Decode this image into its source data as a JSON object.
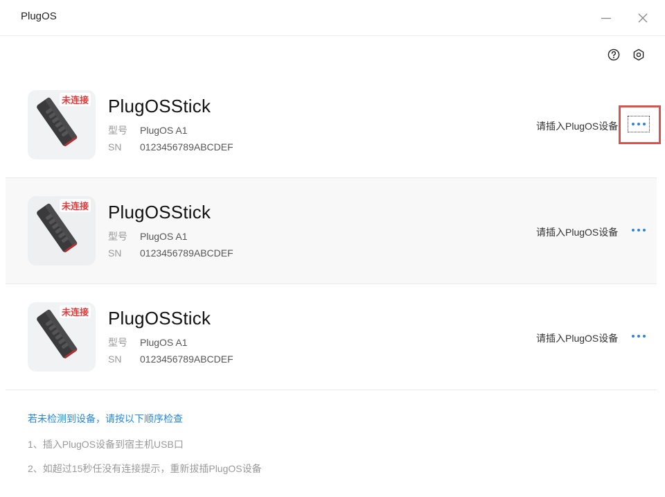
{
  "window": {
    "title": "PlugOS"
  },
  "devices": [
    {
      "status": "未连接",
      "name": "PlugOSStick",
      "model_label": "型号",
      "model": "PlugOS A1",
      "sn_label": "SN",
      "sn": "0123456789ABCDEF",
      "hint": "请插入PlugOS设备"
    },
    {
      "status": "未连接",
      "name": "PlugOSStick",
      "model_label": "型号",
      "model": "PlugOS A1",
      "sn_label": "SN",
      "sn": "0123456789ABCDEF",
      "hint": "请插入PlugOS设备"
    },
    {
      "status": "未连接",
      "name": "PlugOSStick",
      "model_label": "型号",
      "model": "PlugOS A1",
      "sn_label": "SN",
      "sn": "0123456789ABCDEF",
      "hint": "请插入PlugOS设备"
    }
  ],
  "tips": {
    "title": "若未检测到设备，请按以下顺序检查",
    "steps": [
      "1、插入PlugOS设备到宿主机USB口",
      "2、如超过15秒任没有连接提示，重新拔插PlugOS设备"
    ]
  },
  "icons": {
    "help": "help-circle-icon",
    "settings": "gear-icon",
    "minimize": "minimize-icon",
    "close": "close-icon",
    "more": "more-dots-icon",
    "usb_stick": "usb-stick-icon"
  },
  "colors": {
    "accent": "#2a86d6",
    "status_disconnected": "#e03a3a",
    "highlight": "#d9534f"
  }
}
